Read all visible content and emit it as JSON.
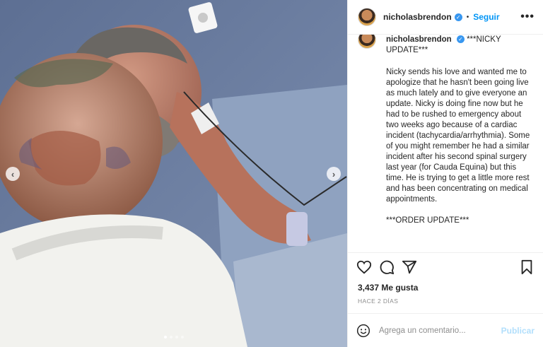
{
  "post": {
    "username": "nicholasbrendon",
    "follow_label": "Seguir",
    "separator": "•",
    "more_label": "•••",
    "caption_title": "***NICKY UPDATE***",
    "caption_body": "Nicky sends his love and wanted me to apologize that he hasn't been going live as much lately and to give everyone an update. Nicky is doing fine now but he had to be rushed to emergency about two weeks ago because of a cardiac incident (tachycardia/arrhythmia). Some of you might remember he had a similar incident after his second spinal surgery last year (for Cauda Equina) but this time. He is trying to get a little more rest and has been concentrating on medical appointments.\n\n***ORDER UPDATE***",
    "likes": "3,437 Me gusta",
    "time": "HACE 2 DÍAS",
    "comment_placeholder": "Agrega un comentario...",
    "publish_label": "Publicar",
    "carousel": {
      "count": 4,
      "active_index": 0
    }
  },
  "colors": {
    "accent": "#0095f6",
    "verified": "#3897f0",
    "publish_disabled": "#b2dffc",
    "muted": "#8e8e8e"
  },
  "icons": {
    "prev": "chevron-left-icon",
    "next": "chevron-right-icon",
    "like": "heart-icon",
    "comment": "comment-icon",
    "share": "send-icon",
    "save": "bookmark-icon",
    "emoji": "smiley-icon"
  }
}
